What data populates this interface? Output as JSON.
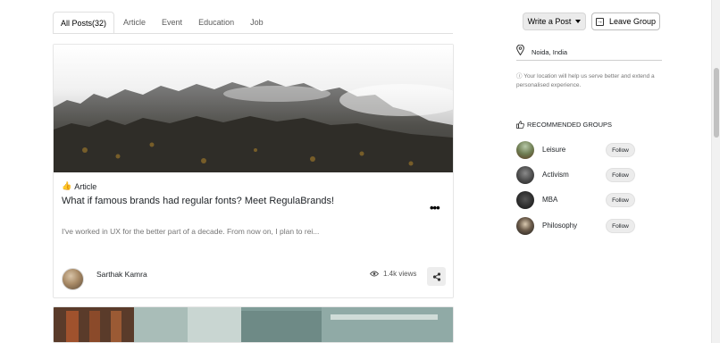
{
  "tabs": [
    {
      "label": "All Posts(32)",
      "active": true
    },
    {
      "label": "Article",
      "active": false
    },
    {
      "label": "Event",
      "active": false
    },
    {
      "label": "Education",
      "active": false
    },
    {
      "label": "Job",
      "active": false
    }
  ],
  "actions": {
    "write_post_label": "Write a Post",
    "leave_group_label": "Leave Group"
  },
  "post": {
    "category_icon": "thumbs-up-emoji-icon",
    "category": "Article",
    "title": "What if famous brands had regular fonts? Meet RegulaBrands!",
    "excerpt": "I've worked in UX for the better part of a decade. From now on, I plan to rei...",
    "author": "Sarthak Kamra",
    "views": "1.4k views"
  },
  "sidebar": {
    "location": "Noida, India",
    "location_note": "Your location will help us serve better and extend a personalised experience.",
    "recommended_title": "RECOMMENDED GROUPS",
    "follow_label": "Follow",
    "groups": [
      {
        "name": "Leisure"
      },
      {
        "name": "Activism"
      },
      {
        "name": "MBA"
      },
      {
        "name": "Philosophy"
      }
    ]
  }
}
